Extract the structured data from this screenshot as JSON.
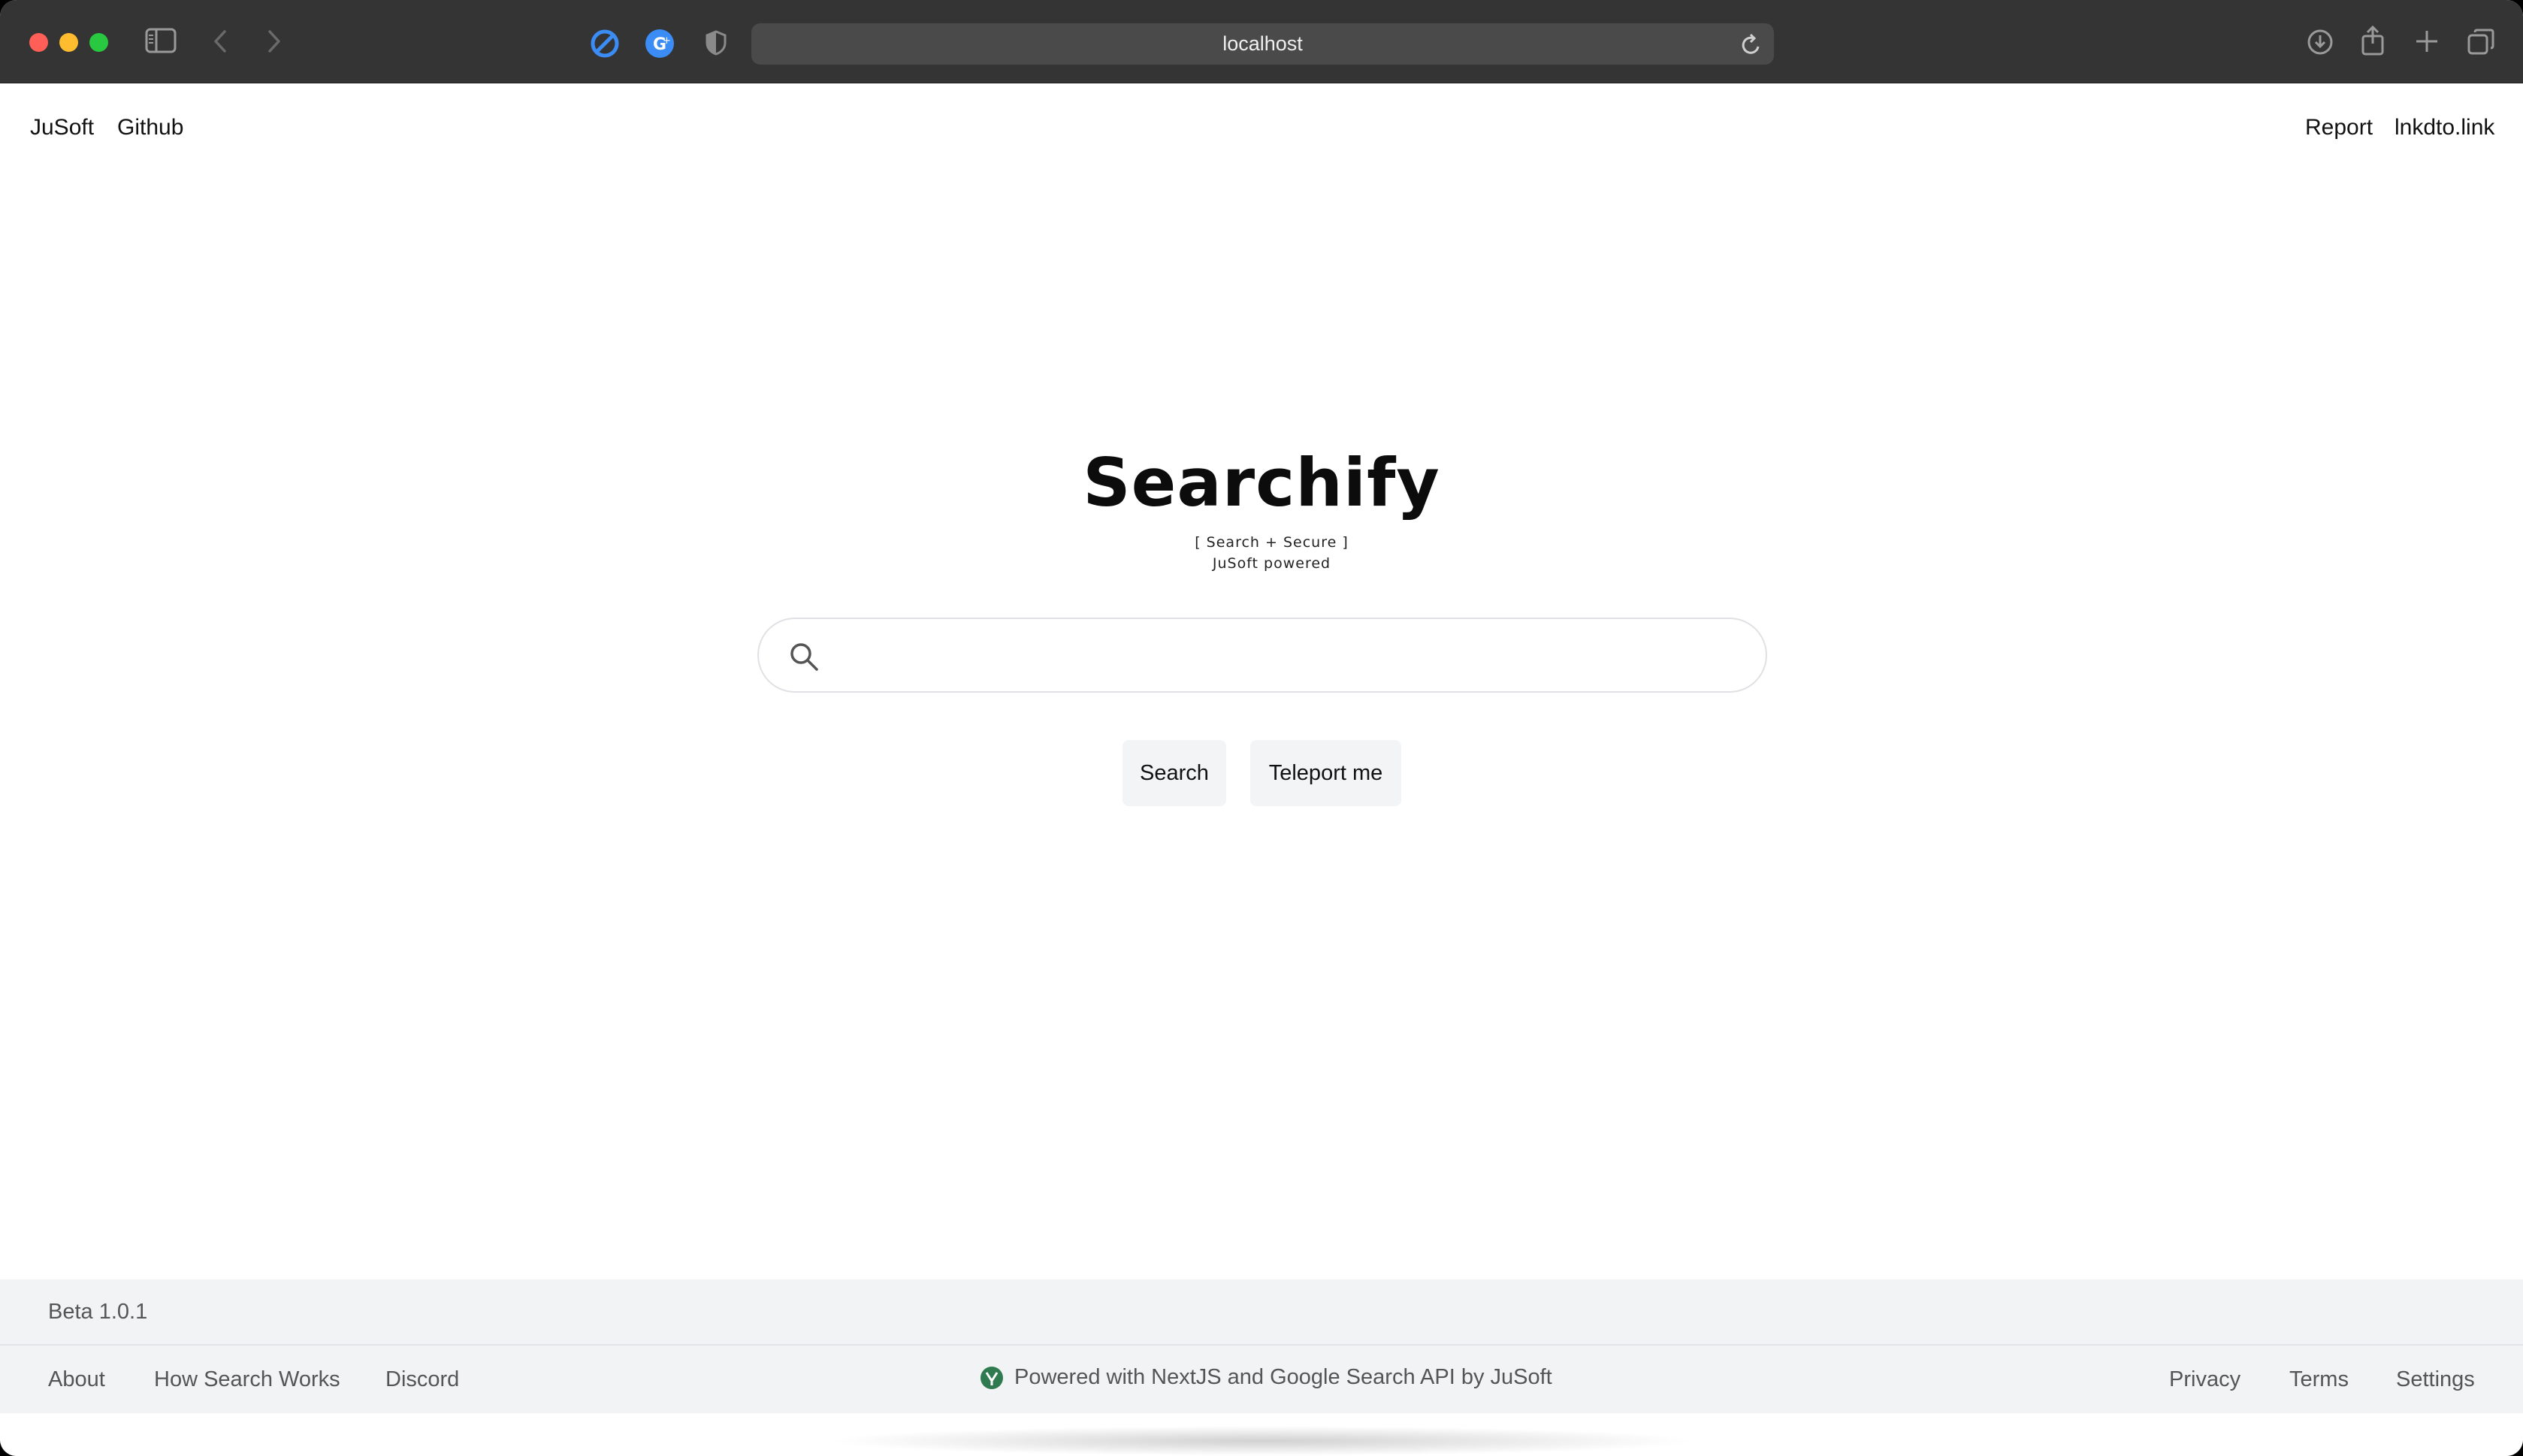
{
  "browser": {
    "url": "localhost",
    "icons": [
      "sidebar-icon",
      "back-icon",
      "forward-icon",
      "blocker-icon",
      "extension-icon",
      "privacy-shield-icon",
      "reload-icon",
      "download-icon",
      "share-icon",
      "new-tab-icon",
      "tabs-overview-icon"
    ]
  },
  "nav": {
    "left": [
      "JuSoft",
      "Github"
    ],
    "right": [
      "Report",
      "lnkdto.link"
    ]
  },
  "hero": {
    "logo": "Searchify",
    "tagline": "[ Search + Secure ]",
    "powered": "JuSoft powered"
  },
  "search": {
    "value": "",
    "placeholder": "",
    "search_button": "Search",
    "teleport_button": "Teleport me"
  },
  "footer": {
    "version": "Beta 1.0.1",
    "left_links": [
      "About",
      "How Search Works",
      "Discord"
    ],
    "center_text": "Powered with NextJS and Google Search API by JuSoft",
    "right_links": [
      "Privacy",
      "Terms",
      "Settings"
    ],
    "leaf_color": "#2f7a4f"
  }
}
